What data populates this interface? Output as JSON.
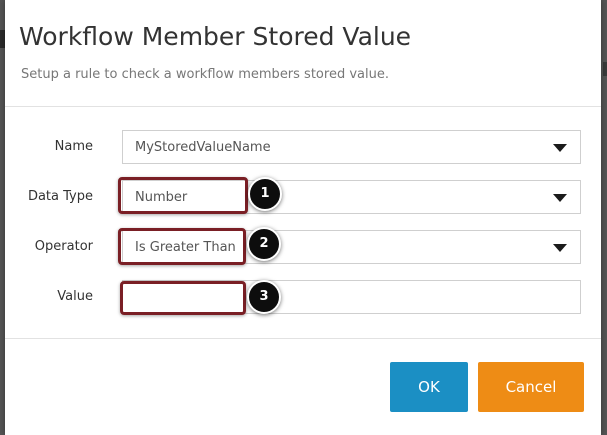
{
  "dialog": {
    "title": "Workflow Member Stored Value",
    "subtitle": "Setup a rule to check a workflow members stored value."
  },
  "form": {
    "name": {
      "label": "Name",
      "value": "MyStoredValueName"
    },
    "data_type": {
      "label": "Data Type",
      "value": "Number"
    },
    "operator": {
      "label": "Operator",
      "value": "Is Greater Than"
    },
    "value": {
      "label": "Value",
      "value": ""
    }
  },
  "callouts": [
    "1",
    "2",
    "3"
  ],
  "buttons": {
    "ok": "OK",
    "cancel": "Cancel"
  },
  "colors": {
    "ok_button": "#1b8fc4",
    "cancel_button": "#ee8c15",
    "highlight": "#7a1f25",
    "badge": "#0d0d0d"
  }
}
